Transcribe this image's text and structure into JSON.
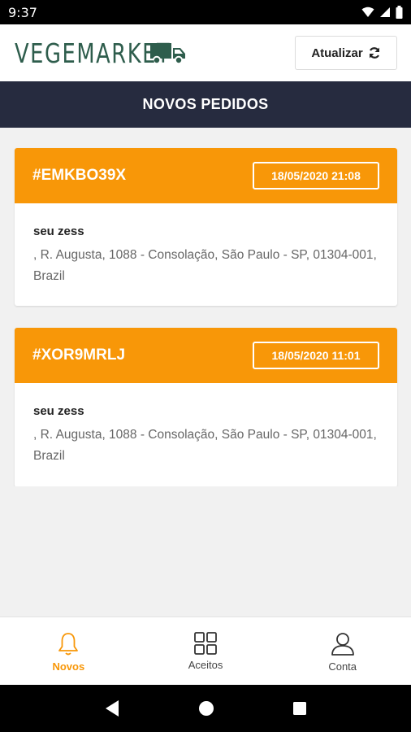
{
  "status_bar": {
    "time": "9:37"
  },
  "header": {
    "brand": "VEGEMARKET",
    "refresh_label": "Atualizar"
  },
  "title": "NOVOS PEDIDOS",
  "orders": [
    {
      "id": "#EMKBO39X",
      "date": "18/05/2020 21:08",
      "customer": "seu zess",
      "address": ", R. Augusta, 1088 - Consolação, São Paulo - SP, 01304-001, Brazil"
    },
    {
      "id": "#XOR9MRLJ",
      "date": "18/05/2020 11:01",
      "customer": "seu zess",
      "address": ", R. Augusta, 1088 - Consolação, São Paulo - SP, 01304-001, Brazil"
    }
  ],
  "bottom_nav": [
    {
      "label": "Novos",
      "icon": "bell-icon",
      "active": true
    },
    {
      "label": "Aceitos",
      "icon": "grid-icon",
      "active": false
    },
    {
      "label": "Conta",
      "icon": "user-icon",
      "active": false
    }
  ],
  "colors": {
    "accent": "#f89708",
    "title_bar": "#262b3f",
    "brand": "#2e5d4c"
  }
}
